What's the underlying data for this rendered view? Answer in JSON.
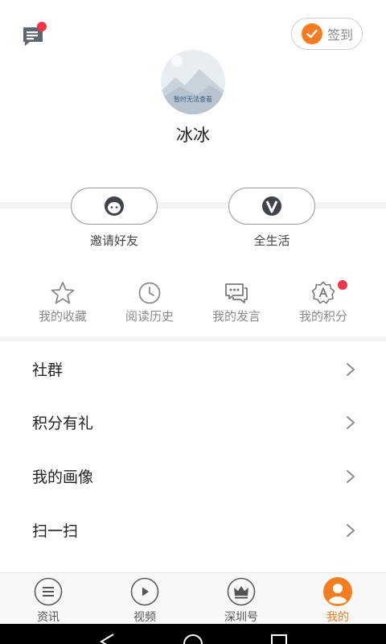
{
  "header": {
    "checkin_label": "签到",
    "avatar_placeholder_text": "暂时无法查看",
    "username": "冰冰"
  },
  "quick_actions": [
    {
      "label": "邀请好友",
      "icon": "face-icon"
    },
    {
      "label": "全生活",
      "icon": "v-badge-icon"
    }
  ],
  "grid": [
    {
      "label": "我的收藏",
      "icon": "star-icon"
    },
    {
      "label": "阅读历史",
      "icon": "clock-icon"
    },
    {
      "label": "我的发言",
      "icon": "chat-icon"
    },
    {
      "label": "我的积分",
      "icon": "points-badge-icon",
      "has_badge": true
    }
  ],
  "menu": [
    {
      "label": "社群"
    },
    {
      "label": "积分有礼"
    },
    {
      "label": "我的画像"
    },
    {
      "label": "扫一扫"
    }
  ],
  "tabbar": [
    {
      "label": "资讯",
      "icon": "list-icon",
      "active": false
    },
    {
      "label": "视频",
      "icon": "play-icon",
      "active": false
    },
    {
      "label": "深圳号",
      "icon": "crown-icon",
      "active": false
    },
    {
      "label": "我的",
      "icon": "person-icon",
      "active": true
    }
  ],
  "colors": {
    "accent": "#f57c1f",
    "badge": "#f2364a"
  }
}
